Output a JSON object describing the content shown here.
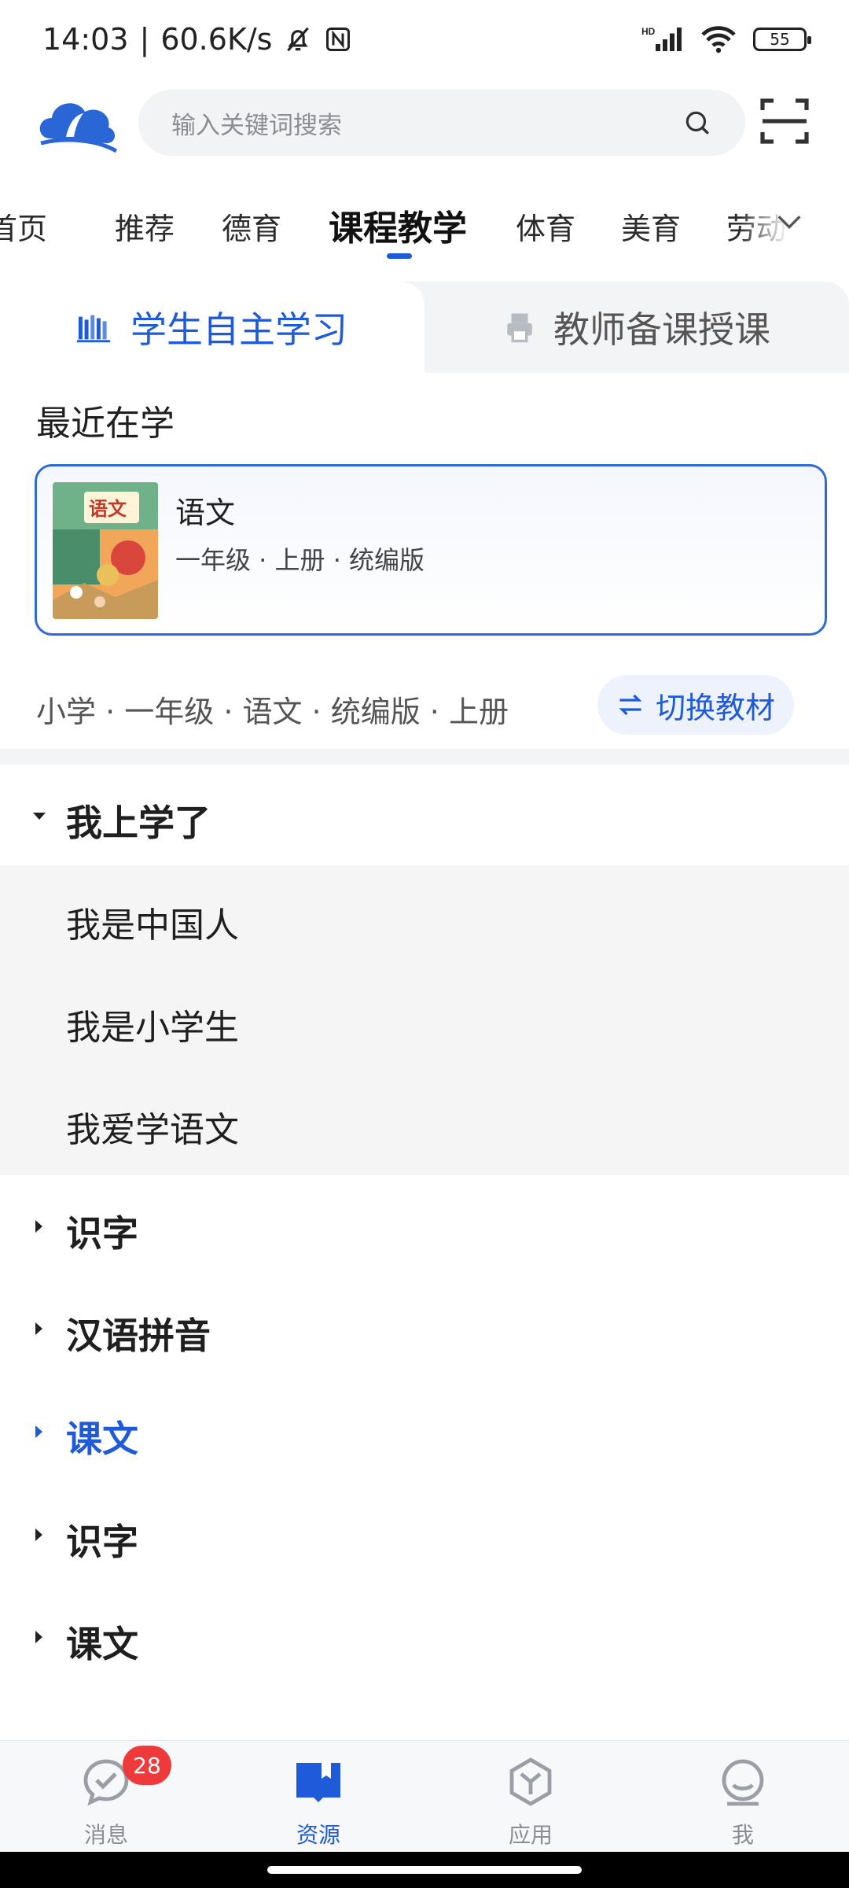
{
  "status_bar": {
    "time": "14:03",
    "network_speed": "60.6K/s",
    "battery": "55",
    "hd_label": "HD"
  },
  "header": {
    "search_placeholder": "输入关键词搜索"
  },
  "category_tabs": [
    {
      "label": "首页"
    },
    {
      "label": "推荐"
    },
    {
      "label": "德育"
    },
    {
      "label": "课程教学",
      "active": true
    },
    {
      "label": "体育"
    },
    {
      "label": "美育"
    },
    {
      "label": "劳动"
    }
  ],
  "segments": {
    "student_label": "学生自主学习",
    "teacher_label": "教师备课授课",
    "active": "student"
  },
  "recent": {
    "title": "最近在学",
    "book_title": "语文",
    "book_meta": "一年级 · 上册 · 统编版",
    "cover_title": "语文"
  },
  "filter": {
    "text": "小学 · 一年级 · 语文 · 统编版 · 上册",
    "switch_label": "切换教材"
  },
  "chapters": [
    {
      "label": "我上学了",
      "expanded": true,
      "items": [
        "我是中国人",
        "我是小学生",
        "我爱学语文"
      ]
    },
    {
      "label": "识字"
    },
    {
      "label": "汉语拼音"
    },
    {
      "label": "课文",
      "active": true
    },
    {
      "label": "识字"
    },
    {
      "label": "课文"
    }
  ],
  "bottom_nav": [
    {
      "label": "消息",
      "badge": "28"
    },
    {
      "label": "资源",
      "active": true
    },
    {
      "label": "应用"
    },
    {
      "label": "我"
    }
  ],
  "colors": {
    "accent": "#1f5bd8",
    "badge": "#ee3a3a",
    "tab_bg": "#f3f4f6"
  }
}
